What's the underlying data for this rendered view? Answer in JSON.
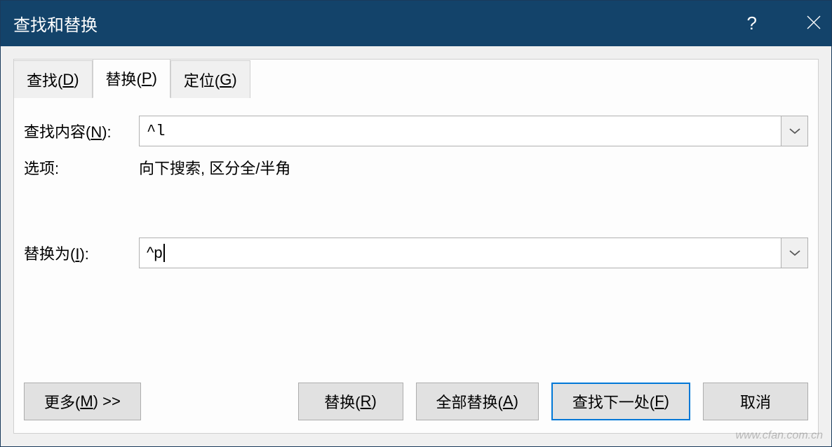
{
  "dialog": {
    "title": "查找和替换",
    "help": "?",
    "close": "×"
  },
  "tabs": {
    "find": {
      "prefix": "查找(",
      "key": "D",
      "suffix": ")"
    },
    "replace": {
      "prefix": "替换(",
      "key": "P",
      "suffix": ")"
    },
    "goto": {
      "prefix": "定位(",
      "key": "G",
      "suffix": ")"
    }
  },
  "form": {
    "find_label_prefix": "查找内容(",
    "find_label_key": "N",
    "find_label_suffix": "):",
    "find_value": "^l",
    "options_label": "选项:",
    "options_value": "向下搜索, 区分全/半角",
    "replace_label_prefix": "替换为(",
    "replace_label_key": "I",
    "replace_label_suffix": "):",
    "replace_value": "^p"
  },
  "buttons": {
    "more_prefix": "更多(",
    "more_key": "M",
    "more_suffix": ") >>",
    "replace_prefix": "替换(",
    "replace_key": "R",
    "replace_suffix": ")",
    "replace_all_prefix": "全部替换(",
    "replace_all_key": "A",
    "replace_all_suffix": ")",
    "find_next_prefix": "查找下一处(",
    "find_next_key": "F",
    "find_next_suffix": ")",
    "cancel": "取消"
  },
  "watermark": "www.cfan.com.cn"
}
